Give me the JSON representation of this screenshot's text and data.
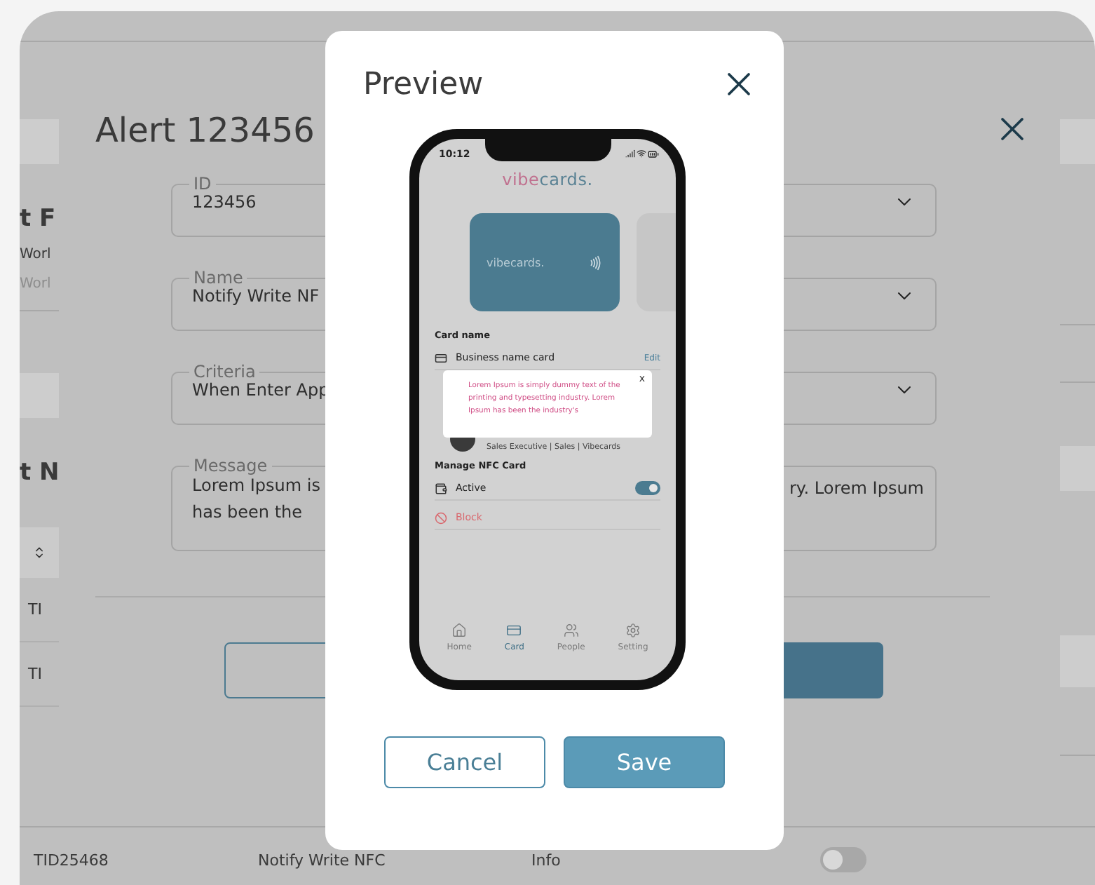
{
  "background": {
    "side_texts": [
      {
        "kind": "heading",
        "text": "t F"
      },
      {
        "kind": "label",
        "text": "Worl"
      },
      {
        "kind": "faint",
        "text": "Worl"
      },
      {
        "kind": "heading",
        "text": "t N"
      }
    ],
    "table_cells": [
      "TI",
      "TI"
    ],
    "bottom_row": {
      "id": "TID25468",
      "name": "Notify Write NFC",
      "type": "Info",
      "switch_on": false
    }
  },
  "alert": {
    "title": "Alert 123456",
    "fields": [
      {
        "label": "ID",
        "value": "123456",
        "kind": "select"
      },
      {
        "label": "Name",
        "value": "Notify Write NF",
        "kind": "select"
      },
      {
        "label": "Criteria",
        "value": "When Enter App",
        "kind": "select"
      },
      {
        "label": "Message",
        "kind": "textarea",
        "lines": [
          "Lorem Ipsum is",
          "has been the"
        ],
        "right_text": "ry. Lorem Ipsum"
      }
    ]
  },
  "preview": {
    "title": "Preview",
    "phone": {
      "time": "10:12",
      "logo": {
        "first": "vibe",
        "rest": "cards."
      },
      "card_logo": "vibecards.",
      "card_section": "Card name",
      "card_row": {
        "label": "Business name card",
        "action": "Edit"
      },
      "profile_subtitle": "Sales Executive | Sales | Vibecards",
      "manage_section": "Manage NFC Card",
      "settings": [
        {
          "kind": "toggle",
          "label": "Active",
          "on": true
        },
        {
          "kind": "danger",
          "label": "Block"
        }
      ],
      "nav": [
        {
          "label": "Home",
          "selected": false
        },
        {
          "label": "Card",
          "selected": true
        },
        {
          "label": "People",
          "selected": false
        },
        {
          "label": "Setting",
          "selected": false
        }
      ],
      "popup": {
        "text": "Lorem Ipsum is simply dummy text of the printing and typesetting industry. Lorem Ipsum has been the industry's",
        "close": "x"
      }
    },
    "buttons": [
      {
        "label": "Cancel",
        "kind": "outline"
      },
      {
        "label": "Save",
        "kind": "primary"
      }
    ]
  }
}
